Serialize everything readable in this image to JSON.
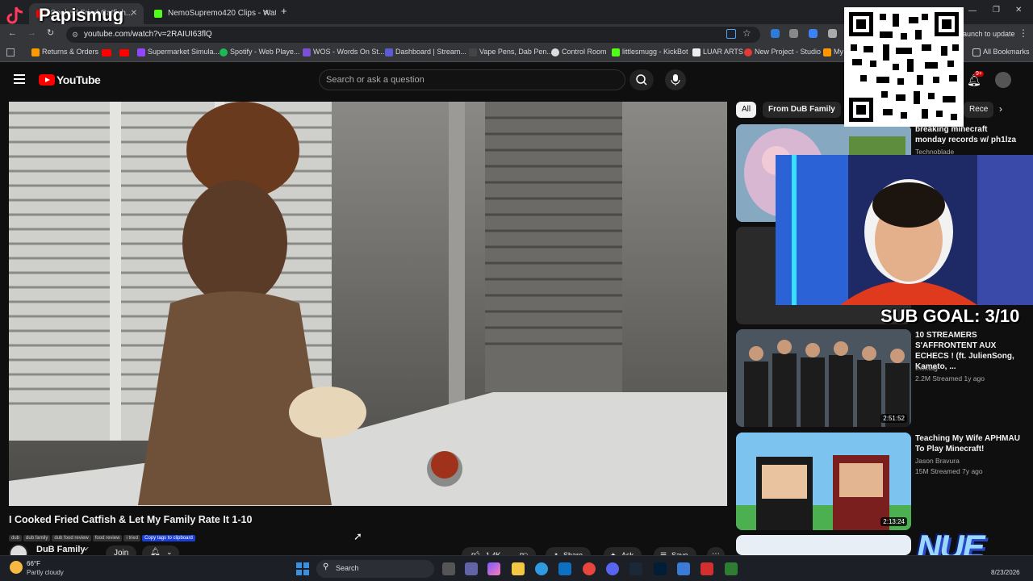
{
  "browser": {
    "tabs": [
      {
        "label": "Cooked Fried Catfish...",
        "active": true
      },
      {
        "label": "NemoSupremo420 Clips - Watc",
        "active": false
      }
    ],
    "new_tab": "+",
    "url": "youtube.com/watch?v=2RAIUI63flQ",
    "update_label": "Launch to update",
    "bookmarks": [
      "Returns & Orders",
      "Supermarket Simula...",
      "Spotify - Web Playe...",
      "WOS - Words On St...",
      "Dashboard | Stream...",
      "Vape Pens, Dab Pen...",
      "Control Room",
      "littlesmugg - KickBot",
      "LUAR ARTS",
      "New Project - Studio",
      "My"
    ],
    "all_bookmarks": "All Bookmarks"
  },
  "overlay": {
    "streamer_name": "Papismug",
    "sub_goal": "SUB GOAL: 3/10",
    "logo_text": "NUE"
  },
  "youtube": {
    "logo_text": "YouTube",
    "search_placeholder": "Search or ask a question",
    "notification_count": "9+",
    "video": {
      "title": "I Cooked Fried Catfish & Let My Family Rate It 1-10",
      "tags": [
        "dub",
        "dub family",
        "dub food review",
        "food review",
        "i tried"
      ],
      "copy_tags": "Copy tags to clipboard",
      "channel": "DuB Family",
      "join": "Join",
      "likes": "1.4K",
      "share": "Share",
      "ask": "Ask",
      "save": "Save"
    },
    "chips": [
      "All",
      "From DuB Family",
      "Rece"
    ],
    "recommendations": [
      {
        "title": "breaking minecraft monday records w/ ph1lza",
        "channel": "Technoblade",
        "meta": "",
        "duration": ""
      },
      {
        "title": "10 STREAMERS S'AFFRONTENT AUX ECHECS ! (ft. JulienSong, Kameto, ...",
        "channel": "Inoxtag",
        "meta": "2.2M  Streamed 1y ago",
        "duration": "2:51:52"
      },
      {
        "title": "Teaching My Wife APHMAU To Play Minecraft!",
        "channel": "Jason Bravura",
        "meta": "15M  Streamed 7y ago",
        "duration": "2:13:24"
      }
    ]
  },
  "taskbar": {
    "temp": "66°F",
    "weather": "Partly cloudy",
    "search": "Search",
    "date": "8/23/2026"
  },
  "colors": {
    "accent_red": "#ff0000",
    "chip_active": "#f1f1f1",
    "tag_blue": "#1a3fd6"
  }
}
